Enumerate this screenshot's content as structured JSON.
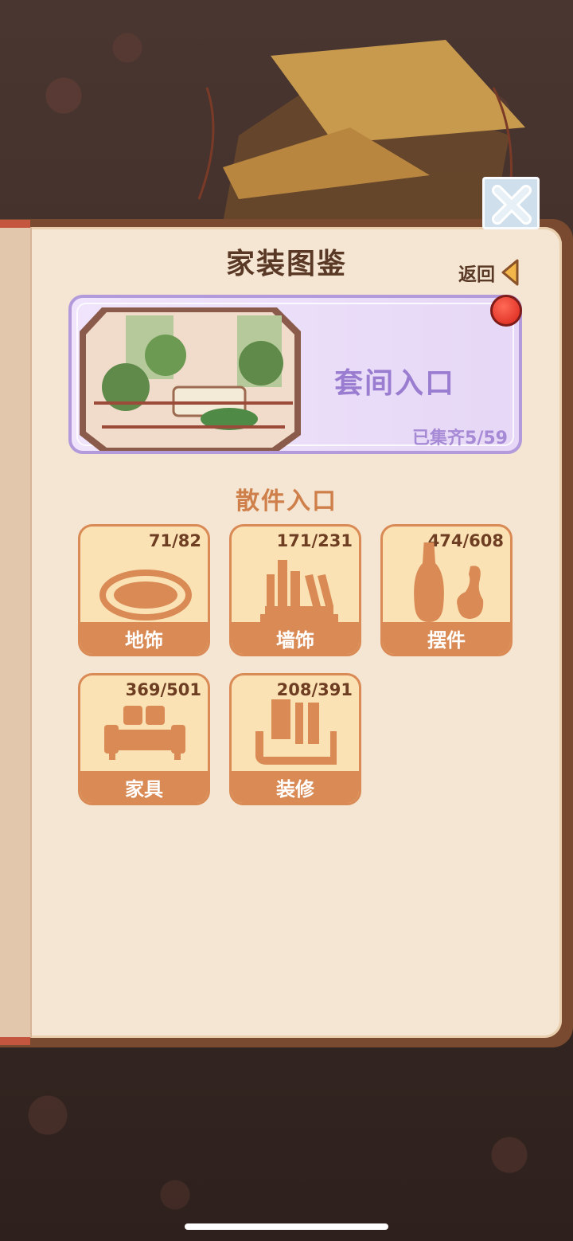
{
  "header": {
    "title": "家装图鉴",
    "back_label": "返回"
  },
  "suite": {
    "label": "套间入口",
    "progress": "已集齐5/59"
  },
  "section_title": "散件入口",
  "categories": [
    {
      "label": "地饰",
      "count": "71/82",
      "icon": "rug-icon"
    },
    {
      "label": "墙饰",
      "count": "171/231",
      "icon": "bookshelf-icon"
    },
    {
      "label": "摆件",
      "count": "474/608",
      "icon": "vase-icon"
    },
    {
      "label": "家具",
      "count": "369/501",
      "icon": "sofa-icon"
    },
    {
      "label": "装修",
      "count": "208/391",
      "icon": "wallpaper-icon"
    }
  ],
  "colors": {
    "accent": "#d98a55",
    "suite_purple": "#b39adb",
    "notification_red": "#d8231b"
  }
}
